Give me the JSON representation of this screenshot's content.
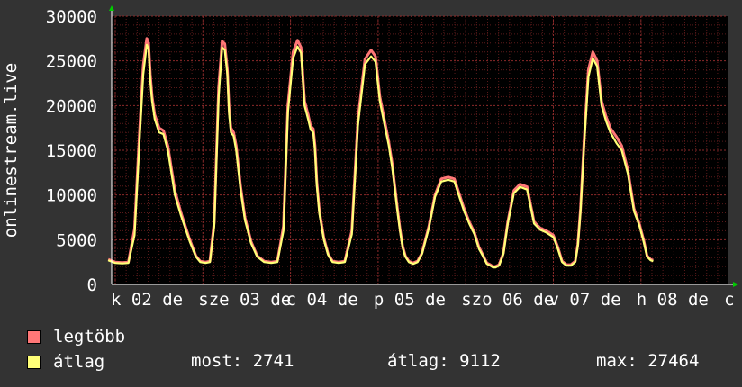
{
  "chart_data": {
    "type": "line",
    "ylabel": "onlinestream.live",
    "ylim": [
      0,
      30000
    ],
    "y_ticks": [
      0,
      5000,
      10000,
      15000,
      20000,
      25000,
      30000
    ],
    "x_tick_labels": [
      "k 02 de",
      "sze 03 de",
      "c 04 de",
      "p 05 de",
      "szo 06 de",
      "v 07 de",
      "h 08 de",
      "c"
    ],
    "x_ticks_days": [
      0,
      1,
      2,
      3,
      4,
      5,
      6,
      7
    ],
    "grid": true,
    "colors": {
      "background": "#333333",
      "plot": "#000000",
      "grid": "#5a1a1a",
      "max_series": "#ff7777",
      "avg_series": "#ffff77",
      "text": "#ffffff",
      "arrow": "#00cc00"
    },
    "series": [
      {
        "name": "legtöbb",
        "color": "#ff7777",
        "day": [
          -0.08,
          0,
          0.08,
          0.15,
          0.22,
          0.28,
          0.32,
          0.36,
          0.38,
          0.4,
          0.42,
          0.45,
          0.5,
          0.55,
          0.6,
          0.68,
          0.75,
          0.85,
          0.92,
          0.97,
          1.03,
          1.08,
          1.13,
          1.18,
          1.22,
          1.25,
          1.28,
          1.3,
          1.32,
          1.35,
          1.38,
          1.43,
          1.48,
          1.55,
          1.62,
          1.7,
          1.78,
          1.85,
          1.92,
          1.97,
          2.03,
          2.08,
          2.12,
          2.16,
          2.2,
          2.23,
          2.26,
          2.28,
          2.3,
          2.33,
          2.38,
          2.43,
          2.48,
          2.55,
          2.62,
          2.7,
          2.77,
          2.85,
          2.92,
          2.97,
          3.02,
          3.07,
          3.12,
          3.16,
          3.19,
          3.22,
          3.25,
          3.28,
          3.31,
          3.35,
          3.4,
          3.45,
          3.5,
          3.58,
          3.65,
          3.72,
          3.8,
          3.87,
          3.93,
          3.98,
          4.04,
          4.1,
          4.15,
          4.2,
          4.24,
          4.28,
          4.31,
          4.34,
          4.38,
          4.43,
          4.48,
          4.55,
          4.62,
          4.7,
          4.78,
          4.85,
          4.92,
          5.0,
          5.05,
          5.1,
          5.15,
          5.2,
          5.25,
          5.28,
          5.31,
          5.35,
          5.4,
          5.45,
          5.5,
          5.55,
          5.6,
          5.65,
          5.72,
          5.78,
          5.85,
          5.92,
          5.98,
          6.03,
          6.07,
          6.11,
          6.14,
          6.17,
          6.2,
          6.23,
          6.26,
          6.29,
          6.33,
          6.37,
          6.4,
          6.45,
          6.5,
          6.55,
          6.6,
          6.65,
          6.7
        ],
        "values": [
          2800,
          2500,
          2450,
          2500,
          6200,
          17500,
          24500,
          27500,
          27000,
          23500,
          21000,
          19000,
          17500,
          17200,
          15500,
          10500,
          8000,
          5000,
          3200,
          2600,
          2500,
          2600,
          7000,
          22000,
          27200,
          26900,
          24000,
          19500,
          17500,
          17000,
          15500,
          11000,
          7500,
          4800,
          3200,
          2600,
          2500,
          2600,
          6500,
          20000,
          26000,
          27300,
          26500,
          20500,
          19000,
          17700,
          17400,
          15500,
          11500,
          8200,
          5200,
          3400,
          2600,
          2500,
          2600,
          6000,
          18500,
          25200,
          26200,
          25500,
          21000,
          18500,
          16000,
          13500,
          11000,
          8500,
          6200,
          4300,
          3200,
          2600,
          2400,
          2600,
          3500,
          6500,
          10000,
          11800,
          12000,
          11800,
          10000,
          8500,
          7000,
          5800,
          4200,
          3200,
          2400,
          2200,
          2000,
          2000,
          2200,
          3500,
          7000,
          10500,
          11200,
          10900,
          7000,
          6300,
          6000,
          5500,
          4200,
          2600,
          2200,
          2200,
          2600,
          4500,
          8500,
          16000,
          24000,
          26000,
          25000,
          20500,
          18800,
          17500,
          16500,
          15500,
          12800,
          8500,
          6800,
          5000,
          3200,
          2800,
          2700
        ],
        "values_note": ""
      },
      {
        "name": "átlag",
        "color": "#ffff77",
        "day": [
          -0.08,
          0,
          0.08,
          0.15,
          0.22,
          0.28,
          0.32,
          0.36,
          0.38,
          0.4,
          0.42,
          0.45,
          0.5,
          0.55,
          0.6,
          0.68,
          0.75,
          0.85,
          0.92,
          0.97,
          1.03,
          1.08,
          1.13,
          1.18,
          1.22,
          1.25,
          1.28,
          1.3,
          1.32,
          1.35,
          1.38,
          1.43,
          1.48,
          1.55,
          1.62,
          1.7,
          1.78,
          1.85,
          1.92,
          1.97,
          2.03,
          2.08,
          2.12,
          2.16,
          2.2,
          2.23,
          2.26,
          2.28,
          2.3,
          2.33,
          2.38,
          2.43,
          2.48,
          2.55,
          2.62,
          2.7,
          2.77,
          2.85,
          2.92,
          2.97,
          3.02,
          3.07,
          3.12,
          3.16,
          3.19,
          3.22,
          3.25,
          3.28,
          3.31,
          3.35,
          3.4,
          3.45,
          3.5,
          3.58,
          3.65,
          3.72,
          3.8,
          3.87,
          3.93,
          3.98,
          4.04,
          4.1,
          4.15,
          4.2,
          4.24,
          4.28,
          4.31,
          4.34,
          4.38,
          4.43,
          4.48,
          4.55,
          4.62,
          4.7,
          4.78,
          4.85,
          4.92,
          5.0,
          5.05,
          5.1,
          5.15,
          5.2,
          5.25,
          5.28,
          5.31,
          5.35,
          5.4,
          5.45,
          5.5,
          5.55,
          5.6,
          5.65,
          5.72,
          5.78,
          5.85,
          5.92,
          5.98,
          6.03,
          6.07,
          6.11,
          6.14,
          6.17,
          6.2,
          6.23,
          6.26,
          6.29,
          6.33,
          6.37,
          6.4,
          6.45,
          6.5,
          6.55,
          6.6,
          6.65,
          6.7
        ],
        "values": [
          2700,
          2400,
          2350,
          2400,
          5500,
          16500,
          23500,
          26800,
          26300,
          22800,
          20500,
          18500,
          17000,
          16800,
          15000,
          10000,
          7700,
          4800,
          3100,
          2500,
          2400,
          2500,
          6500,
          21000,
          26500,
          26200,
          23500,
          19000,
          17000,
          16600,
          15000,
          10600,
          7200,
          4600,
          3100,
          2500,
          2400,
          2500,
          6000,
          19200,
          25300,
          26600,
          25900,
          20000,
          18500,
          17300,
          17000,
          15000,
          11100,
          7900,
          5000,
          3300,
          2500,
          2400,
          2500,
          5600,
          17800,
          24600,
          25500,
          24900,
          20500,
          18000,
          15600,
          13100,
          10700,
          8200,
          6000,
          4100,
          3100,
          2500,
          2300,
          2500,
          3400,
          6300,
          9800,
          11500,
          11700,
          11500,
          9700,
          8200,
          6800,
          5600,
          4000,
          3100,
          2300,
          2100,
          1900,
          1900,
          2100,
          3400,
          6800,
          10200,
          10900,
          10600,
          6800,
          6100,
          5800,
          5300,
          4000,
          2500,
          2100,
          2100,
          2500,
          4300,
          8200,
          15500,
          23200,
          25300,
          24400,
          20000,
          18300,
          17000,
          15800,
          15000,
          12400,
          8200,
          6600,
          4800,
          3100,
          2700,
          2600
        ]
      }
    ]
  },
  "legend": {
    "items": [
      {
        "label": "legtöbb",
        "color": "#ff7777"
      },
      {
        "label": "átlag",
        "color": "#ffff77"
      }
    ],
    "stats": {
      "most_label": "most:",
      "most_value": "2741",
      "atlag_label": "átlag:",
      "atlag_value": "9112",
      "max_label": "max:",
      "max_value": "27464"
    }
  }
}
